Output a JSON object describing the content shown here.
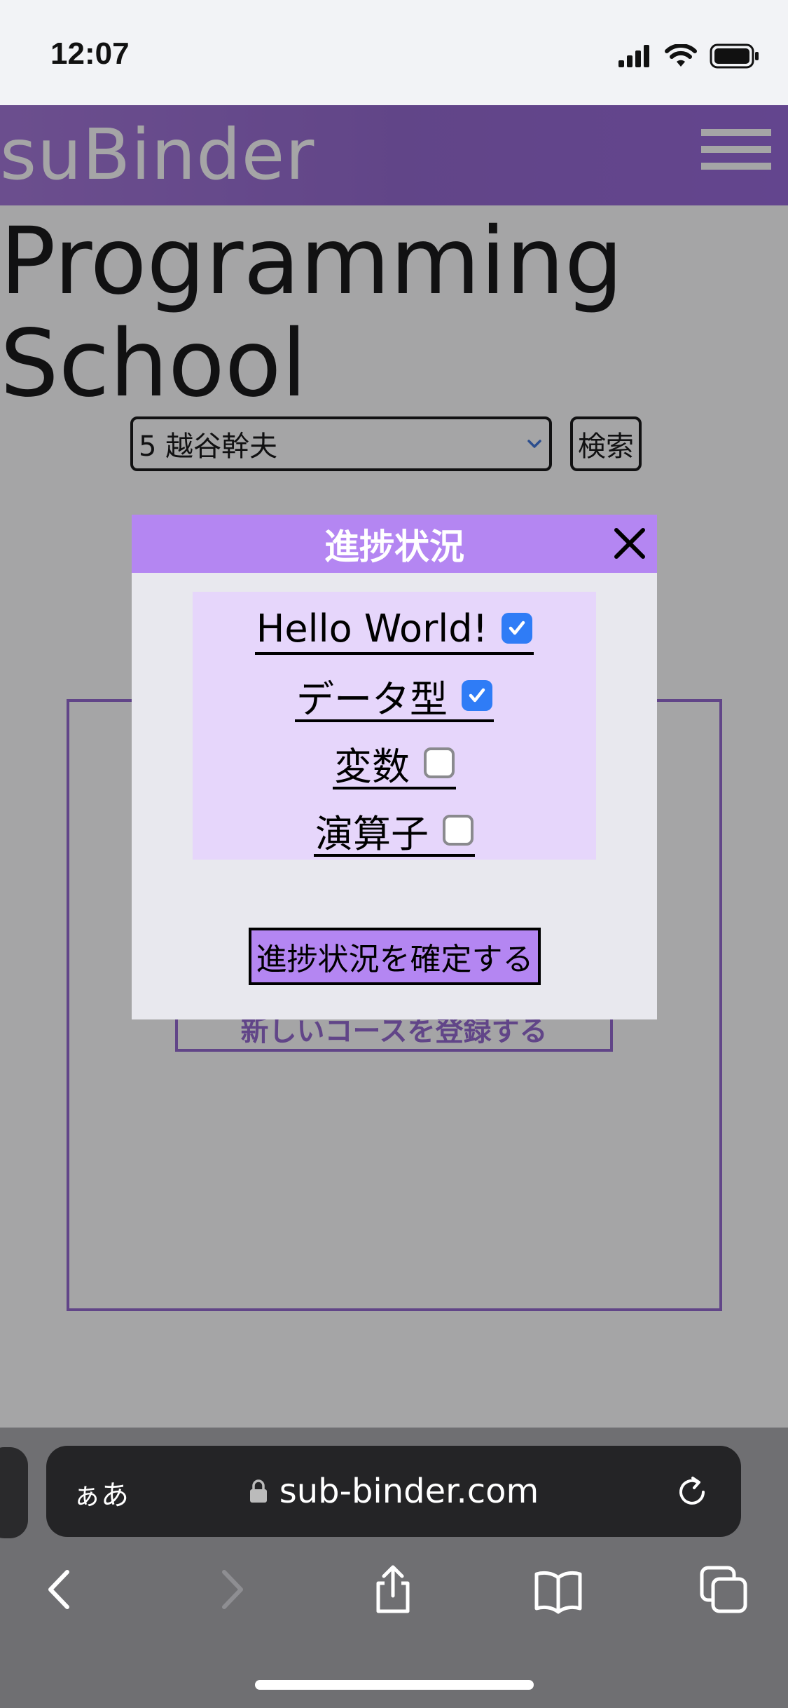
{
  "status_bar": {
    "time": "12:07"
  },
  "header": {
    "brand": "suBinder",
    "menu_icon": "hamburger-icon"
  },
  "page": {
    "title_line1": "Programming",
    "title_line2": "School",
    "select": {
      "value": "5 越谷幹夫"
    },
    "search_label": "検索",
    "register_label": "新しいコースを登録する"
  },
  "modal": {
    "title": "進捗状況",
    "items": [
      {
        "label": "Hello World!",
        "checked": true
      },
      {
        "label": "データ型",
        "checked": true
      },
      {
        "label": "変数",
        "checked": false
      },
      {
        "label": "演算子",
        "checked": false
      }
    ],
    "confirm_label": "進捗状況を確定する"
  },
  "browser": {
    "aa_label": "ぁあ",
    "url": "sub-binder.com"
  },
  "colors": {
    "brand_purple": "#8b5bcc",
    "modal_header": "#b486f2",
    "checkbox_blue": "#2f7cf6"
  }
}
